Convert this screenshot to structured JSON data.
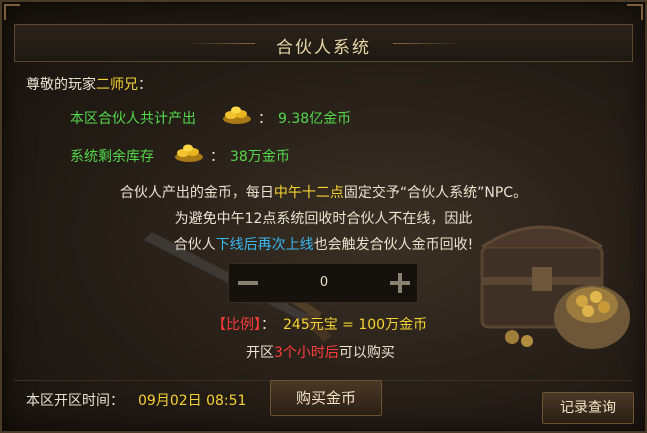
{
  "title": "合伙人系统",
  "greeting": {
    "prefix": "尊敬的玩家",
    "name": "二师兄",
    "suffix": "："
  },
  "output": {
    "label": "本区合伙人共计产出",
    "sep": "：",
    "value": "9.38亿金币"
  },
  "stock": {
    "label": "系统剩余库存",
    "sep": "：",
    "value": "38万金币"
  },
  "desc": {
    "l1_a": "合伙人产出的金币，每日",
    "l1_b": "中午十二点",
    "l1_c": "固定交予“合伙人系统”NPC。",
    "l2": "为避免中午12点系统回收时合伙人不在线，因此",
    "l3_a": "合伙人",
    "l3_b": "下线后再次上线",
    "l3_c": "也会触发合伙人金币回收!"
  },
  "stepper": {
    "value": "0",
    "minus": "−",
    "plus": "+"
  },
  "ratio": {
    "label": "【比例】",
    "sep": "：",
    "value": "245元宝 = 100万金币"
  },
  "open_info": {
    "a": "开区",
    "b": "3个小时后",
    "c": "可以购买"
  },
  "open_time": {
    "label": "本区开区时间：",
    "value": "09月02日 08:51"
  },
  "buttons": {
    "buy": "购买金币",
    "records": "记录查询"
  },
  "icons": {
    "gold": "gold-coins-icon",
    "minus": "minus-icon",
    "plus": "plus-icon"
  }
}
